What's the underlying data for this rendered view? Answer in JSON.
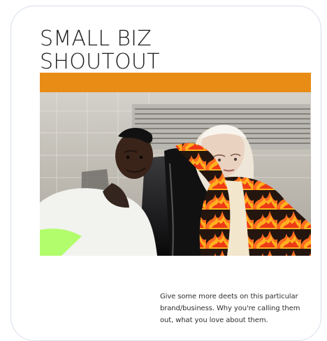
{
  "card": {
    "title_line_1": "SMALL BIZ",
    "title_line_2": "SHOUTOUT",
    "body_text": "Give some more deets on this particular brand/business. Why you're calling them out, what you love about them."
  },
  "photo": {
    "subject": "two-people-on-bench-photo",
    "colors": {
      "orange_band": "#e98c16",
      "tile_wall": "#cdcac2",
      "white_shirt": "#f2f2ef",
      "leather_seat": "#1b1b1c",
      "flame_orange": "#ff6d1f",
      "flame_yellow": "#ffb11e",
      "neon_green": "#a6ff55"
    }
  }
}
